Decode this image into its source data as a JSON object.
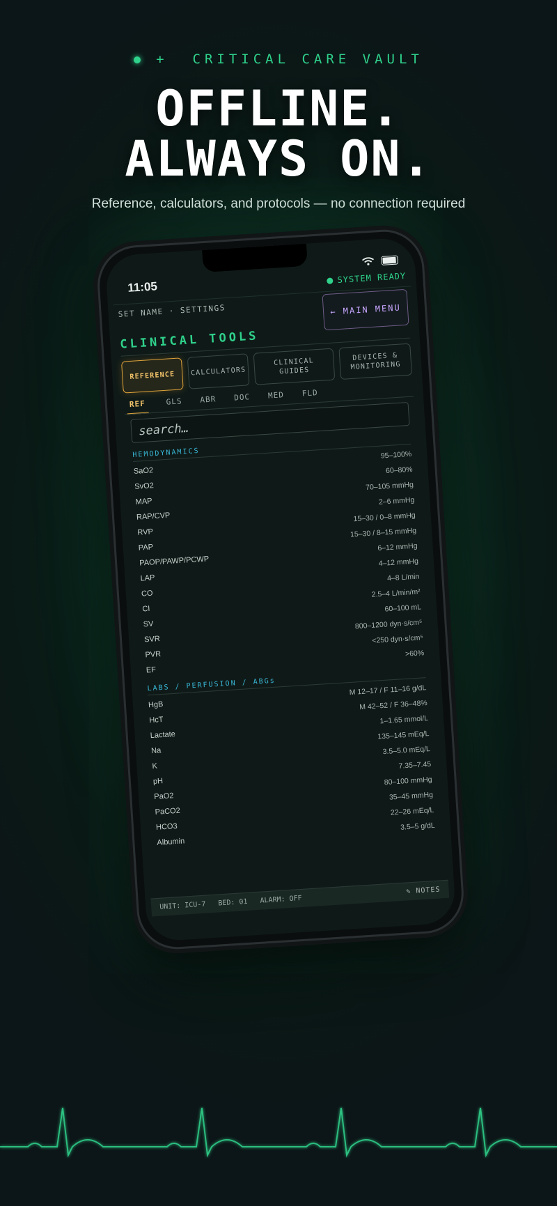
{
  "hero": {
    "eyebrow_prefix": "+",
    "eyebrow": "CRITICAL CARE VAULT",
    "headline_line1": "OFFLINE.",
    "headline_line2": "ALWAYS ON.",
    "subline": "Reference, calculators, and protocols — no connection required"
  },
  "status_bar": {
    "time": "11:05",
    "system_status": "SYSTEM READY"
  },
  "app": {
    "top_links": "SET NAME · SETTINGS",
    "menu_button": "← MAIN MENU",
    "title": "CLINICAL TOOLS",
    "main_tabs": [
      {
        "label": "REFERENCE",
        "active": true
      },
      {
        "label": "CALCULATORS",
        "active": false
      },
      {
        "label": "CLINICAL GUIDES",
        "active": false
      },
      {
        "label": "DEVICES & MONITORING",
        "active": false
      }
    ],
    "sub_tabs": [
      {
        "label": "REF",
        "active": true
      },
      {
        "label": "GLS",
        "active": false
      },
      {
        "label": "ABR",
        "active": false
      },
      {
        "label": "DOC",
        "active": false
      },
      {
        "label": "MED",
        "active": false
      },
      {
        "label": "FLD",
        "active": false
      }
    ],
    "search_placeholder": "search…",
    "sections": [
      {
        "title": "HEMODYNAMICS",
        "rows": [
          {
            "name": "SaO2",
            "value": "95–100%"
          },
          {
            "name": "SvO2",
            "value": "60–80%"
          },
          {
            "name": "MAP",
            "value": "70–105 mmHg"
          },
          {
            "name": "RAP/CVP",
            "value": "2–6 mmHg"
          },
          {
            "name": "RVP",
            "value": "15–30 / 0–8 mmHg"
          },
          {
            "name": "PAP",
            "value": "15–30 / 8–15 mmHg"
          },
          {
            "name": "PAOP/PAWP/PCWP",
            "value": "6–12 mmHg"
          },
          {
            "name": "LAP",
            "value": "4–12 mmHg"
          },
          {
            "name": "CO",
            "value": "4–8 L/min"
          },
          {
            "name": "CI",
            "value": "2.5–4 L/min/m²"
          },
          {
            "name": "SV",
            "value": "60–100 mL"
          },
          {
            "name": "SVR",
            "value": "800–1200 dyn·s/cm⁵"
          },
          {
            "name": "PVR",
            "value": "<250 dyn·s/cm⁵"
          },
          {
            "name": "EF",
            "value": ">60%"
          }
        ]
      },
      {
        "title": "LABS / PERFUSION / ABGs",
        "rows": [
          {
            "name": "HgB",
            "value": "M 12–17 / F 11–16 g/dL"
          },
          {
            "name": "HcT",
            "value": "M 42–52 / F 36–48%"
          },
          {
            "name": "Lactate",
            "value": "1–1.65 mmol/L"
          },
          {
            "name": "Na",
            "value": "135–145 mEq/L"
          },
          {
            "name": "K",
            "value": "3.5–5.0 mEq/L"
          },
          {
            "name": "pH",
            "value": "7.35–7.45"
          },
          {
            "name": "PaO2",
            "value": "80–100 mmHg"
          },
          {
            "name": "PaCO2",
            "value": "35–45 mmHg"
          },
          {
            "name": "HCO3",
            "value": "22–26 mEq/L"
          },
          {
            "name": "Albumin",
            "value": "3.5–5 g/dL"
          }
        ]
      }
    ],
    "footer": {
      "unit": "UNIT: ICU-7",
      "bed": "BED: 01",
      "alarm": "ALARM: OFF",
      "notes": "✎ NOTES"
    }
  },
  "colors": {
    "accent_green": "#2fd18b",
    "accent_amber": "#e0a43a",
    "accent_cyan": "#39b7d6",
    "accent_purple": "#c9a7ff"
  }
}
